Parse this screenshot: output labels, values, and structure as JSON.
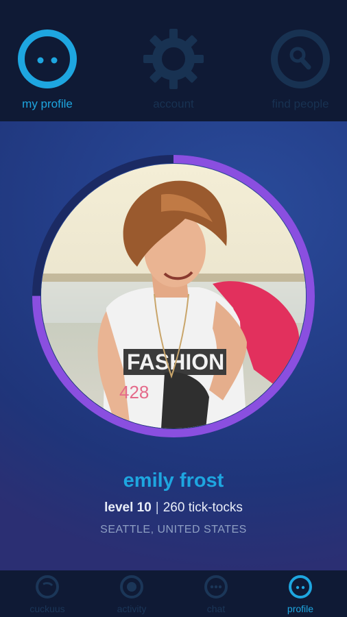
{
  "top_nav": {
    "tabs": [
      {
        "label": "my profile",
        "icon": "face-icon",
        "active": true
      },
      {
        "label": "account",
        "icon": "gear-icon",
        "active": false
      },
      {
        "label": "find people",
        "icon": "search-icon",
        "active": false
      }
    ]
  },
  "profile": {
    "name": "emily frost",
    "level": "level 10",
    "separator": "|",
    "tick_tocks": "260 tick-tocks",
    "location": "SEATTLE, UNITED STATES",
    "level_progress": 0.75
  },
  "bottom_nav": {
    "tabs": [
      {
        "label": "cuckuus",
        "icon": "cuckuus-icon",
        "active": false
      },
      {
        "label": "activity",
        "icon": "activity-icon",
        "active": false
      },
      {
        "label": "chat",
        "icon": "chat-icon",
        "active": false
      },
      {
        "label": "profile",
        "icon": "profile-icon",
        "active": true
      }
    ]
  },
  "colors": {
    "accent": "#1ea6e0",
    "inactive": "#183252",
    "ring": "#8a4fe0",
    "ring_track": "#1b2a63",
    "background": "#0f1a35"
  }
}
